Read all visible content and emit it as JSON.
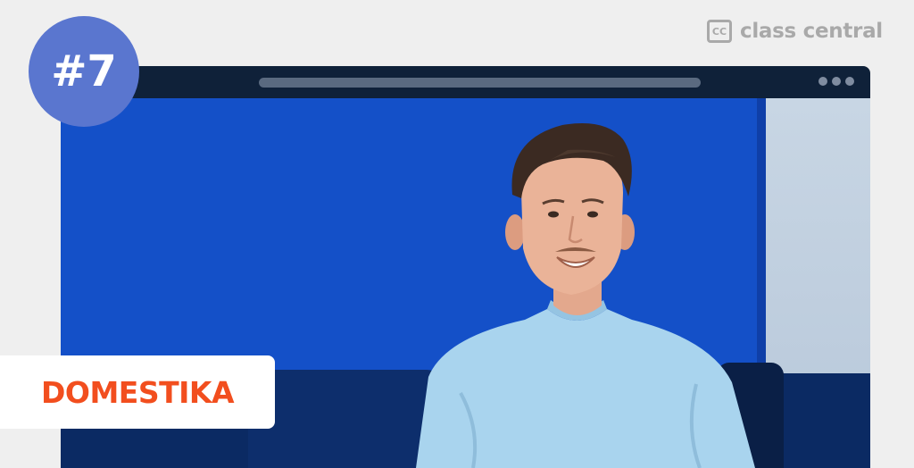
{
  "header": {
    "brand_mark": "CC",
    "brand_name": "class central"
  },
  "badge": {
    "rank": "#7"
  },
  "provider": {
    "name": "DOMESTIKA"
  },
  "colors": {
    "background": "#efefef",
    "badge": "#5a76cf",
    "browser_frame": "#0f2139",
    "photo_backdrop": "#1450c8",
    "provider_accent": "#f24e1e"
  },
  "icons": {
    "brand_mark": "class-central-logo-icon",
    "window_controls": "window-dots-icon"
  }
}
